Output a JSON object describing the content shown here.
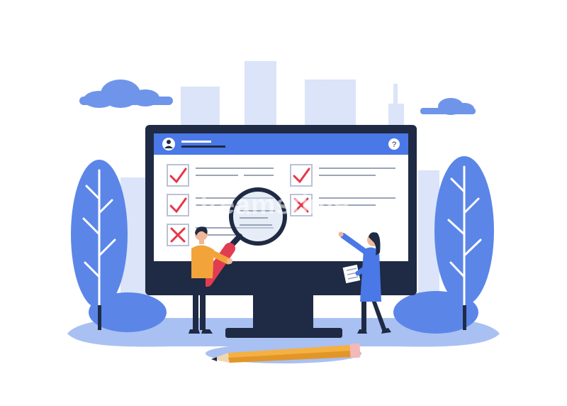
{
  "watermark": {
    "text": "dreamstime."
  },
  "window": {
    "help_icon": "help-icon",
    "user_icon": "user-avatar-icon"
  },
  "checklist": [
    {
      "status": "checked"
    },
    {
      "status": "checked"
    },
    {
      "status": "crossed"
    },
    {
      "status": "checked"
    },
    {
      "status": "crossed"
    }
  ],
  "colors": {
    "monitor": "#1f2a44",
    "screen_header": "#4a78e6",
    "screen": "#ffffff",
    "check": "#e5374a",
    "accent_blue": "#4a78e6",
    "tree": "#5b86e8",
    "background_city": "#dbe4f8",
    "ground": "#a9c0f2",
    "pencil": "#f5b042",
    "man_shirt": "#f2a43a",
    "magnifier_handle": "#e23c52"
  }
}
